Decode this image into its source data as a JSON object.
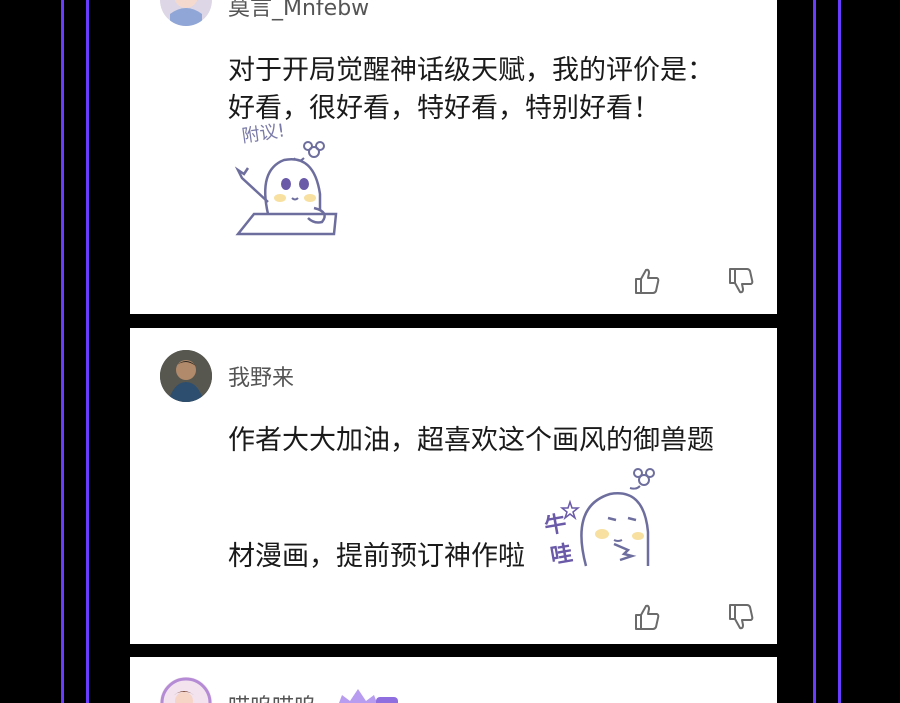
{
  "theme": {
    "frame_color": "#6a3cff",
    "bg": "#000000",
    "card_bg": "#ffffff"
  },
  "comments": [
    {
      "username": "莫言_Mnfebw",
      "lines": [
        "对于开局觉醒神话级天赋，我的评价是：",
        "好看，很好看，特好看，特别好看！"
      ],
      "sticker_icon": "fuyi-sticker-icon",
      "sticker_text": "附议!",
      "like_icon": "thumbs-up-icon",
      "dislike_icon": "thumbs-down-icon"
    },
    {
      "username": "我野来",
      "lines": [
        "作者大大加油，超喜欢这个画风的御兽题",
        "材漫画，提前预订神作啦"
      ],
      "sticker_icon": "niuwa-sticker-icon",
      "sticker_text": "牛哇",
      "like_icon": "thumbs-up-icon",
      "dislike_icon": "thumbs-down-icon"
    },
    {
      "username": "喵呜喵呜",
      "badge_icon": "purple-badge-icon"
    }
  ]
}
